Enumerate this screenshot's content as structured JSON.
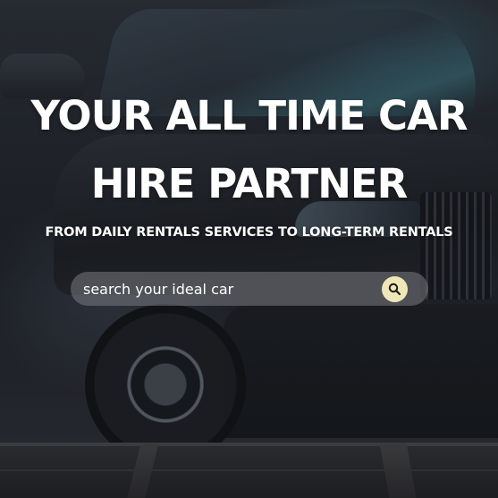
{
  "hero": {
    "headline": "YOUR ALL TIME CAR HIRE PARTNER",
    "subheadline": "FROM DAILY RENTALS SERVICES TO LONG-TERM RENTALS"
  },
  "search": {
    "placeholder": "search your ideal car",
    "icon": "search-icon"
  },
  "colors": {
    "search_button": "#efe7b8",
    "text": "#ffffff"
  }
}
